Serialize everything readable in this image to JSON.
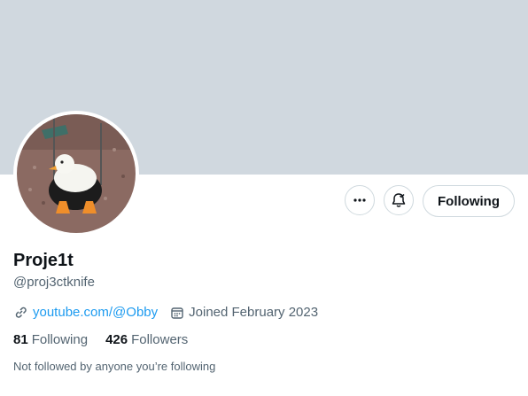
{
  "profile": {
    "display_name": "Proje1t",
    "handle": "@proj3ctknife",
    "website": "youtube.com/@Obby",
    "joined": "Joined February 2023",
    "following_count": "81",
    "following_label": "Following",
    "followers_count": "426",
    "followers_label": "Followers",
    "followed_by_note": "Not followed by anyone you’re following"
  },
  "actions": {
    "follow_button_label": "Following",
    "more_icon": "more-horizontal-icon",
    "notify_icon": "bell-check-icon"
  },
  "colors": {
    "banner": "#d0d8df",
    "link": "#1d9bf0",
    "secondary_text": "#536471",
    "border": "#cfd9de"
  }
}
